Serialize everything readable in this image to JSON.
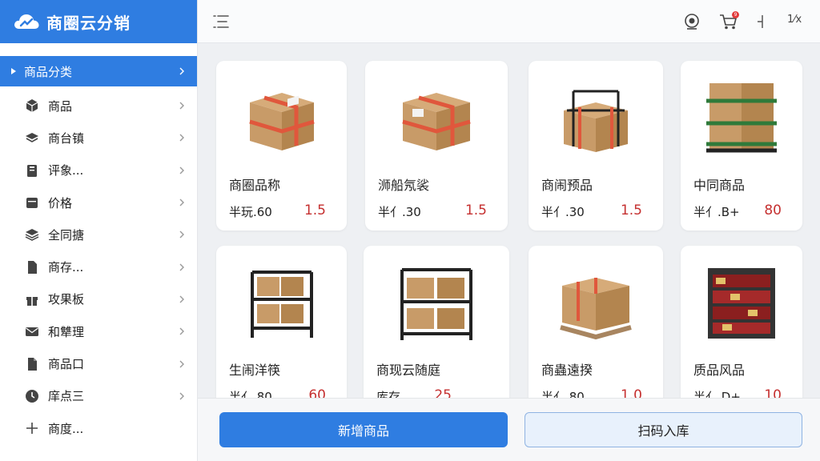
{
  "app": {
    "title": "商圈云分销"
  },
  "sidebar": {
    "items": [
      {
        "label": "商品分类",
        "icon": "caret-right-icon",
        "active": true
      },
      {
        "label": "商品",
        "icon": "cube-icon"
      },
      {
        "label": "商台镇",
        "icon": "layers-icon"
      },
      {
        "label": "评象...",
        "icon": "clipboard-icon"
      },
      {
        "label": "价格",
        "icon": "calendar-icon"
      },
      {
        "label": "全同搪",
        "icon": "stack-icon"
      },
      {
        "label": "商存...",
        "icon": "document-icon"
      },
      {
        "label": "攻果板",
        "icon": "gift-icon"
      },
      {
        "label": "和犨理",
        "icon": "mail-icon"
      },
      {
        "label": "商品口",
        "icon": "file-icon"
      },
      {
        "label": "庠点三",
        "icon": "clock-icon"
      },
      {
        "label": "商度...",
        "icon": "plus-icon"
      }
    ]
  },
  "topbar": {
    "x_text": "1⁄x",
    "badge": "9"
  },
  "products": [
    {
      "name": "商圈品称",
      "label": "半玩.60",
      "value": "1.5",
      "image": "taped-box"
    },
    {
      "name": "浉船氖裟",
      "label": "半⺅.30",
      "value": "1.5",
      "image": "taped-box"
    },
    {
      "name": "商闹预品",
      "label": "半⺅.30",
      "value": "1.5",
      "image": "box-cage"
    },
    {
      "name": "中同商品",
      "label": "半⺅.B+",
      "value": "80",
      "image": "pallet-green"
    },
    {
      "name": "生闹洋筷",
      "label": "半⺅.80",
      "value": "60",
      "image": "shelf-boxes"
    },
    {
      "name": "商现云随庭",
      "label": "库存",
      "value": "25",
      "image": "shelf-boxes"
    },
    {
      "name": "商蟲遠揆",
      "label": "半⺅.80",
      "value": "1.0",
      "image": "box-pallet"
    },
    {
      "name": "质品风品",
      "label": "半⺅.D+",
      "value": "10",
      "image": "red-rack"
    }
  ],
  "actions": {
    "add_product": "新增商品",
    "scan_stock": "扫码入库"
  },
  "colors": {
    "brand": "#2f7de1",
    "price": "#c53030",
    "box": "#c89b68",
    "tape": "#e0573c"
  }
}
